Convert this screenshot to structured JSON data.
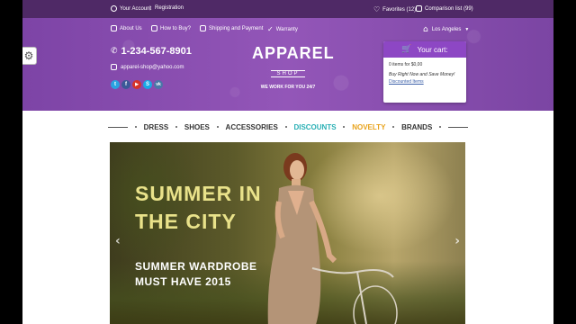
{
  "topbar": {
    "account_label": "Your Account",
    "registration_label": "Registration",
    "favorites_label": "Favorites (12)",
    "comparison_label": "Comparison list (99)"
  },
  "header": {
    "nav": {
      "about_label": "About Us",
      "how_to_buy_label": "How to Buy?",
      "shipping_label": "Shipping and Payment",
      "warranty_label": "Warranty"
    },
    "phone": "1-234-567-8901",
    "email": "apparel-shop@yahoo.com",
    "socials": [
      {
        "icon": "twitter-icon",
        "glyph": "t",
        "color": "#2aa3e0"
      },
      {
        "icon": "facebook-icon",
        "glyph": "f",
        "color": "#3b5998"
      },
      {
        "icon": "youtube-icon",
        "glyph": "▶",
        "color": "#d6332a"
      },
      {
        "icon": "skype-icon",
        "glyph": "S",
        "color": "#19a9e5"
      },
      {
        "icon": "vk-icon",
        "glyph": "vk",
        "color": "#4a76a8"
      }
    ],
    "logo_main": "APPAREL",
    "logo_sub": "SHOP",
    "tagline": "WE WORK FOR YOU 24/7",
    "city": "Los Angeles"
  },
  "cart": {
    "title": "Your cart:",
    "items_text": "0 items for $0,00",
    "promo_text": "Buy Right Now and Save Money!",
    "discount_link": "Discounted Items"
  },
  "menu": {
    "items": [
      {
        "label": "DRESS",
        "color": "#333333"
      },
      {
        "label": "SHOES",
        "color": "#333333"
      },
      {
        "label": "ACCESSORIES",
        "color": "#333333"
      },
      {
        "label": "DISCOUNTS",
        "color": "#2ab0b5"
      },
      {
        "label": "NOVELTY",
        "color": "#e8a21a"
      },
      {
        "label": "BRANDS",
        "color": "#333333"
      }
    ]
  },
  "hero": {
    "title_line1": "SUMMER IN",
    "title_line2": "THE CITY",
    "subtitle_line1": "SUMMER WARDROBE",
    "subtitle_line2": "MUST HAVE 2015"
  },
  "colors": {
    "topbar": "#4f2966",
    "header": "#8a4fb0",
    "cart_accent": "#8d47c4",
    "hero_title": "#e9e28a"
  }
}
